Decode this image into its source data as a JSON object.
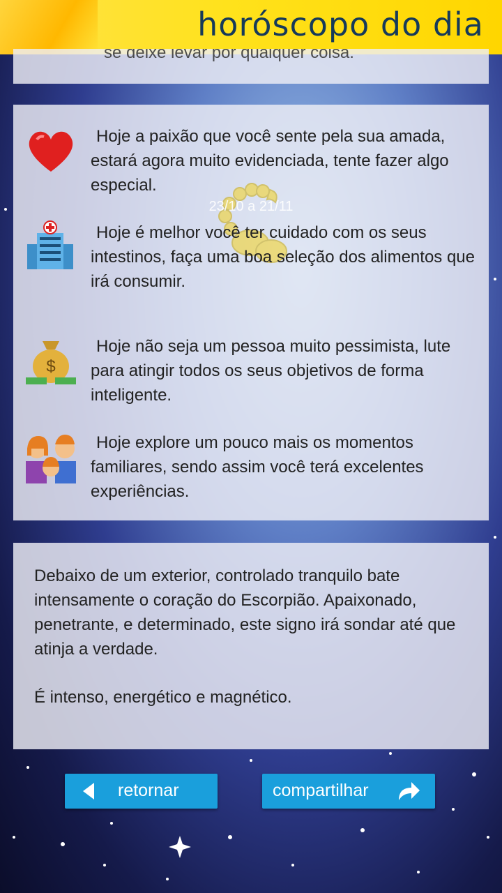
{
  "header": {
    "title": "horóscopo do dia"
  },
  "top_panel": {
    "partial_text": "se deixe levar por qualquer coisa."
  },
  "sign": {
    "date_range": "23/10 a 21/11"
  },
  "entries": [
    {
      "icon": "heart-icon",
      "text": "Hoje a paixão que você sente pela sua amada, estará agora muito evidenciada, tente fazer algo especial."
    },
    {
      "icon": "hospital-icon",
      "text": "Hoje é melhor você ter cuidado com os seus intestinos, faça uma boa seleção dos alimentos que irá consumir."
    },
    {
      "icon": "money-bag-icon",
      "text": "Hoje não seja um pessoa muito pessimista, lute para atingir todos os seus objetivos de forma inteligente."
    },
    {
      "icon": "family-icon",
      "text": "Hoje explore um pouco mais os momentos familiares, sendo assim você terá excelentes experiências."
    }
  ],
  "info": {
    "paragraph1": "Debaixo de um exterior, controlado tranquilo bate intensamente o coração do Escorpião. Apaixonado, penetrante, e determinado, este signo irá sondar até que atinja a verdade.",
    "paragraph2": "É intenso, energético e magnético."
  },
  "buttons": {
    "back_label": "retornar",
    "share_label": "compartilhar"
  },
  "colors": {
    "header_bg": "#ffe21c",
    "header_text": "#163a5a",
    "button_bg": "#1a9fdc"
  }
}
